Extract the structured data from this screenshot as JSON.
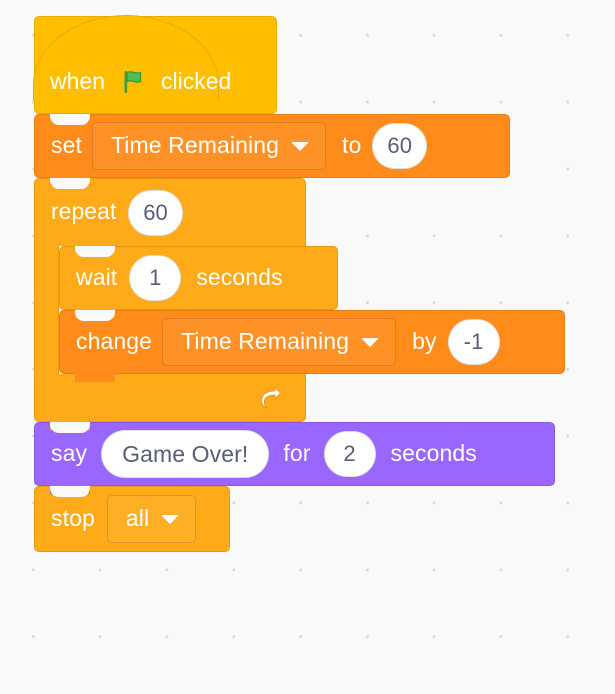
{
  "workspace": {
    "background_color": "#f9f9f9",
    "dot_color": "#d9d9de"
  },
  "palette": {
    "events": "#ffbf00",
    "control": "#ffab19",
    "variables": "#ff8c1a",
    "looks": "#9966ff",
    "input_text": "#575e75",
    "block_text": "#ffffff"
  },
  "script": {
    "hat": {
      "prefix": "when",
      "icon": "green-flag-icon",
      "suffix": "clicked"
    },
    "set_block": {
      "keyword": "set",
      "variable": "Time Remaining",
      "connector": "to",
      "value": "60"
    },
    "repeat_block": {
      "keyword": "repeat",
      "times": "60",
      "loop_icon": "loop-arrow-icon"
    },
    "wait_block": {
      "keyword": "wait",
      "value": "1",
      "unit": "seconds"
    },
    "change_block": {
      "keyword": "change",
      "variable": "Time Remaining",
      "connector": "by",
      "value": "-1"
    },
    "say_block": {
      "keyword": "say",
      "message": "Game Over!",
      "connector": "for",
      "duration": "2",
      "unit": "seconds"
    },
    "stop_block": {
      "keyword": "stop",
      "option": "all"
    }
  }
}
